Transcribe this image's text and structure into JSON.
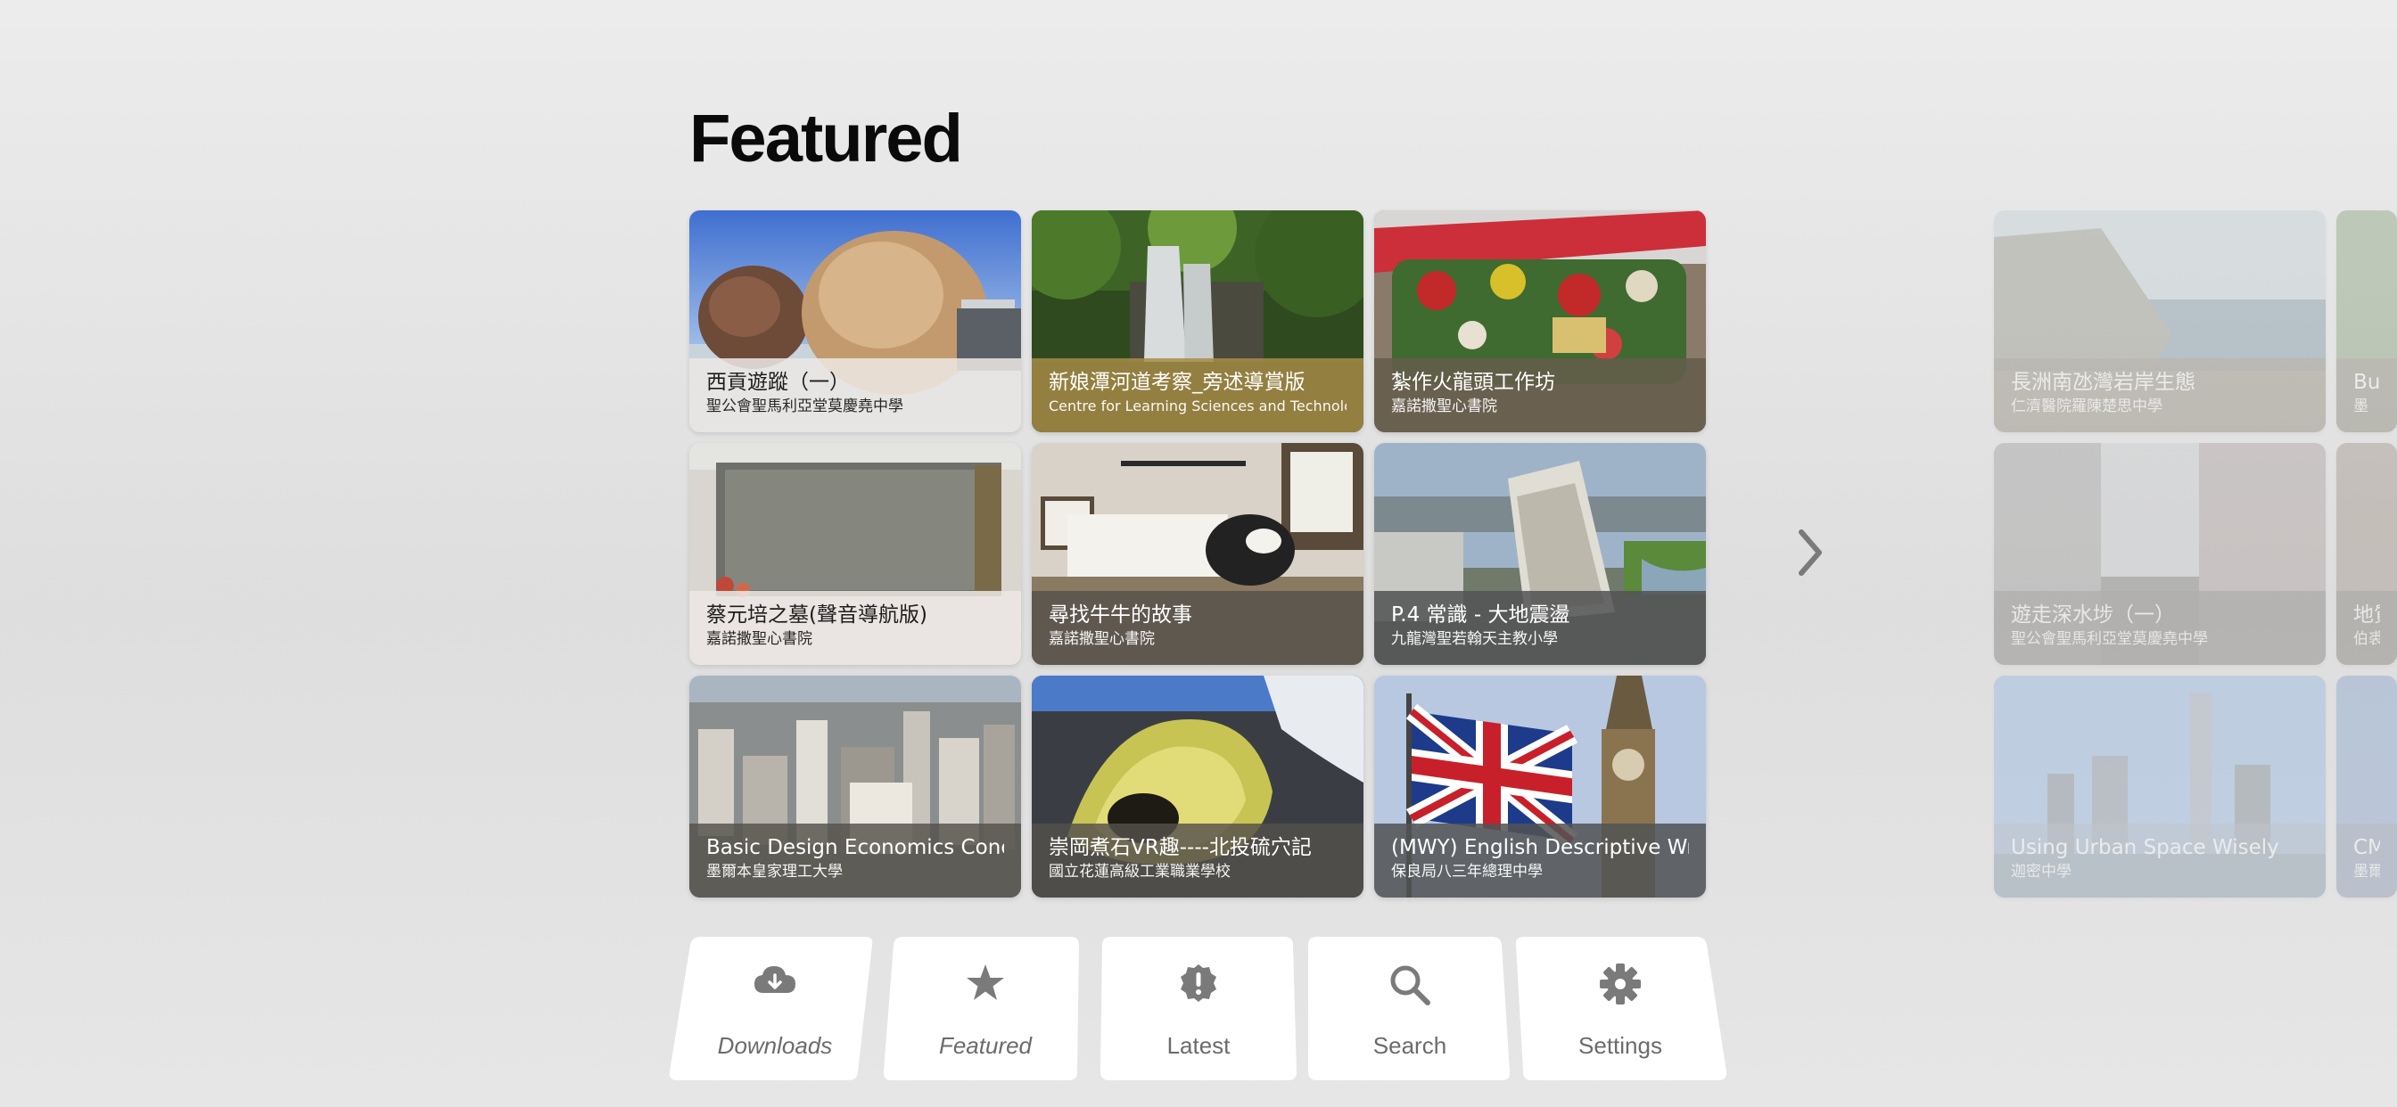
{
  "title": "Featured",
  "colors": {
    "icon": "#777777",
    "label": "#6b6b6b",
    "tab_bg": "#ffffff"
  },
  "featured": [
    {
      "title": "西貢遊蹤（一）",
      "subtitle": "聖公會聖馬利亞堂莫慶堯中學"
    },
    {
      "title": "新娘潭河道考察_旁述導賞版",
      "subtitle": "Centre for Learning Sciences and Technologies"
    },
    {
      "title": "紮作火龍頭工作坊",
      "subtitle": "嘉諾撒聖心書院"
    },
    {
      "title": "蔡元培之墓(聲音導航版)",
      "subtitle": "嘉諾撒聖心書院"
    },
    {
      "title": "尋找牛牛的故事",
      "subtitle": "嘉諾撒聖心書院"
    },
    {
      "title": "P.4 常識 - 大地震盪",
      "subtitle": "九龍灣聖若翰天主教小學"
    },
    {
      "title": "Basic Design Economics Concept- II",
      "subtitle": "墨爾本皇家理工大學"
    },
    {
      "title": "崇岡煮石VR趣----北投硫穴記",
      "subtitle": "國立花蓮高級工業職業學校"
    },
    {
      "title": "(MWY) English Descriptive Writing",
      "subtitle": "保良局八三年總理中學"
    }
  ],
  "next_page": [
    {
      "title": "長洲南氹灣岩岸生態",
      "subtitle": "仁濟醫院羅陳楚思中學"
    },
    {
      "title": "Buil",
      "subtitle": "墨"
    },
    {
      "title": "遊走深水埗（一）",
      "subtitle": "聖公會聖馬利亞堂莫慶堯中學"
    },
    {
      "title": "地質",
      "subtitle": "伯裘"
    },
    {
      "title": "Using Urban Space Wisely",
      "subtitle": "迦密中學"
    },
    {
      "title": "CM G",
      "subtitle": "墨爾"
    }
  ],
  "tabs": [
    {
      "label": "Downloads",
      "icon": "cloud-download-icon"
    },
    {
      "label": "Featured",
      "icon": "star-icon"
    },
    {
      "label": "Latest",
      "icon": "badge-alert-icon"
    },
    {
      "label": "Search",
      "icon": "search-icon"
    },
    {
      "label": "Settings",
      "icon": "gear-icon"
    }
  ]
}
